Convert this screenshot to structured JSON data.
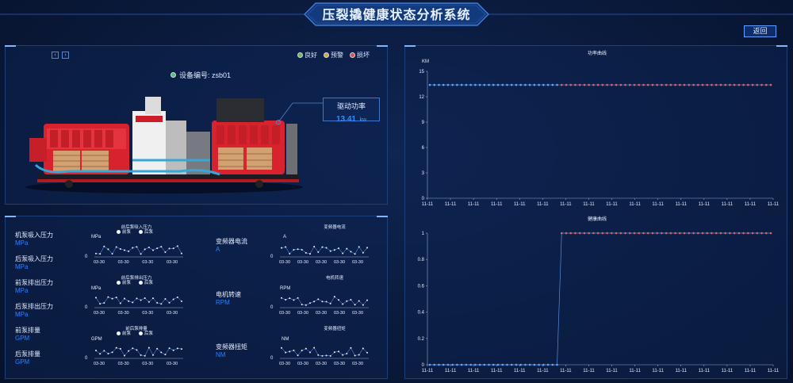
{
  "header": {
    "title": "压裂撬健康状态分析系统",
    "back_label": "返回"
  },
  "colors": {
    "good": "#6fb85a",
    "warn": "#d6a63a",
    "bad": "#d9504a",
    "accent": "#2f80ff"
  },
  "device": {
    "legend": [
      {
        "label": "良好",
        "color": "#6fb85a"
      },
      {
        "label": "预警",
        "color": "#d6a63a"
      },
      {
        "label": "损坏",
        "color": "#d9504a"
      }
    ],
    "pager_prev_icon": "chevron-left-icon",
    "pager_next_icon": "chevron-right-icon",
    "id_label": "设备编号: zsb01",
    "power_label": "驱动功率",
    "power_value": "13.41",
    "power_unit": "kw"
  },
  "metrics_left": [
    {
      "name": "机泵吸入压力",
      "unit": "MPa"
    },
    {
      "name": "后泵吸入压力",
      "unit": "MPa"
    },
    {
      "name": "前泵排出压力",
      "unit": "MPa"
    },
    {
      "name": "后泵排出压力",
      "unit": "MPa"
    },
    {
      "name": "前泵排量",
      "unit": "GPM"
    },
    {
      "name": "后泵排量",
      "unit": "GPM"
    }
  ],
  "metrics_right": [
    {
      "name": "变频器电流",
      "unit": "A"
    },
    {
      "name": "电机转速",
      "unit": "RPM"
    },
    {
      "name": "变频器扭矩",
      "unit": "NM"
    }
  ],
  "mini_charts_left": [
    {
      "title": "前后泵吸入压力",
      "unit": "MPa",
      "legend": [
        "前泵",
        "后泵"
      ],
      "y_tick": "0",
      "x_ticks": [
        "03-30",
        "03-30",
        "03-30",
        "03-30"
      ]
    },
    {
      "title": "前后泵排出压力",
      "unit": "MPa",
      "legend": [
        "前泵",
        "后泵"
      ],
      "y_tick": "0",
      "x_ticks": [
        "03-30",
        "03-30",
        "03-30",
        "03-30"
      ]
    },
    {
      "title": "前后泵排量",
      "unit": "GPM",
      "legend": [
        "前泵",
        "后泵"
      ],
      "y_tick": "0",
      "x_ticks": [
        "03-30",
        "03-30",
        "03-30",
        "03-30"
      ]
    }
  ],
  "mini_charts_right": [
    {
      "title": "变频器电流",
      "unit": "A",
      "y_tick": "0",
      "x_ticks": [
        "03-30",
        "03-30",
        "03-30",
        "03-30",
        "03-30"
      ]
    },
    {
      "title": "电机转速",
      "unit": "RPM",
      "y_tick": "0",
      "x_ticks": [
        "03-30",
        "03-30",
        "03-30",
        "03-30",
        "03-30"
      ]
    },
    {
      "title": "变频器扭矩",
      "unit": "NM",
      "y_tick": "0",
      "x_ticks": [
        "03-30",
        "03-30",
        "03-30",
        "03-30",
        "03-30"
      ]
    }
  ],
  "chart_data": [
    {
      "type": "line",
      "title": "功率曲线",
      "ylabel": "KM",
      "ylim": [
        0,
        15
      ],
      "y_ticks": [
        "0",
        "3",
        "6",
        "9",
        "12",
        "15"
      ],
      "x_tick_label": "11-11",
      "x_tick_count": 16,
      "series": [
        {
          "values": [
            13.4,
            13.4,
            13.4,
            13.4,
            13.4,
            13.4,
            13.4,
            13.4,
            13.4,
            13.4,
            13.4,
            13.4,
            13.4,
            13.4,
            13.4,
            13.4,
            13.4,
            13.4,
            13.4,
            13.4,
            13.4,
            13.4,
            13.4,
            13.4,
            13.4,
            13.4,
            13.4,
            13.4,
            13.4,
            13.4,
            13.4,
            13.4,
            13.4,
            13.4,
            13.4,
            13.4,
            13.4,
            13.4,
            13.4,
            13.4,
            13.4,
            13.4,
            13.4,
            13.4,
            13.4,
            13.4,
            13.4,
            13.4,
            13.4,
            13.4,
            13.4,
            13.4,
            13.4,
            13.4,
            13.4,
            13.4,
            13.4,
            13.4,
            13.4,
            13.4,
            13.4,
            13.4,
            13.4,
            13.4,
            13.4,
            13.4,
            13.4,
            13.4,
            13.4,
            13.4,
            13.4,
            13.4,
            13.4,
            13.4,
            13.4,
            13.4
          ]
        }
      ],
      "split_index": 28,
      "point_colors": [
        "#5aa8ff",
        "#e0616a"
      ]
    },
    {
      "type": "line",
      "title": "健康曲线",
      "ylabel": "",
      "ylim": [
        0,
        1
      ],
      "y_ticks": [
        "0",
        "0.2",
        "0.4",
        "0.6",
        "0.8",
        "1"
      ],
      "x_tick_label": "11-11",
      "x_tick_count": 16,
      "series": [
        {
          "values": [
            0,
            0,
            0,
            0,
            0,
            0,
            0,
            0,
            0,
            0,
            0,
            0,
            0,
            0,
            0,
            0,
            0,
            0,
            0,
            0,
            0,
            0,
            0,
            0,
            0,
            0,
            0,
            0,
            0,
            1,
            1,
            1,
            1,
            1,
            1,
            1,
            1,
            1,
            1,
            1,
            1,
            1,
            1,
            1,
            1,
            1,
            1,
            1,
            1,
            1,
            1,
            1,
            1,
            1,
            1,
            1,
            1,
            1,
            1,
            1,
            1,
            1,
            1,
            1,
            1,
            1,
            1,
            1,
            1,
            1,
            1,
            1,
            1,
            1,
            1,
            1
          ]
        }
      ],
      "split_index": 28,
      "point_colors": [
        "#5aa8ff",
        "#e0616a"
      ]
    }
  ]
}
